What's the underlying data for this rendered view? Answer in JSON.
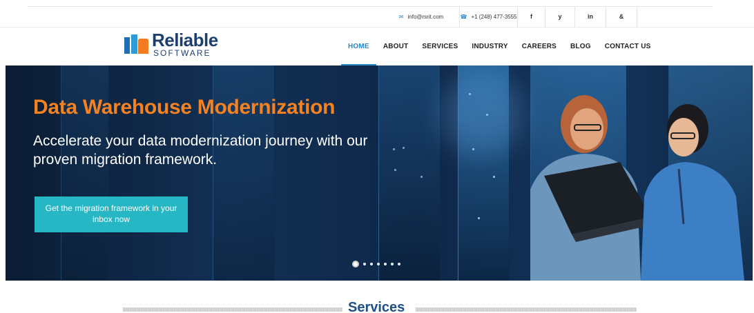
{
  "topbar": {
    "email": "info@rsrit.com",
    "phone": "+1 (248) 477-3555",
    "social": [
      "f",
      "y",
      "in",
      "&"
    ]
  },
  "logo": {
    "line1": "Reliable",
    "line2": "SOFTWARE"
  },
  "nav": {
    "items": [
      "HOME",
      "ABOUT",
      "SERVICES",
      "INDUSTRY",
      "CAREERS",
      "BLOG",
      "CONTACT US"
    ],
    "active": "HOME"
  },
  "hero": {
    "title": "Data Warehouse Modernization",
    "subtitle": "Accelerate your data modernization journey with our proven migration framework.",
    "cta": "Get the migration framework in your inbox now",
    "slide_count": 7,
    "active_slide": 1
  },
  "services": {
    "heading": "Services"
  },
  "colors": {
    "accent": "#2a88c9",
    "orange": "#f58220",
    "teal": "#27b6c4",
    "navy": "#1d3f6e"
  }
}
